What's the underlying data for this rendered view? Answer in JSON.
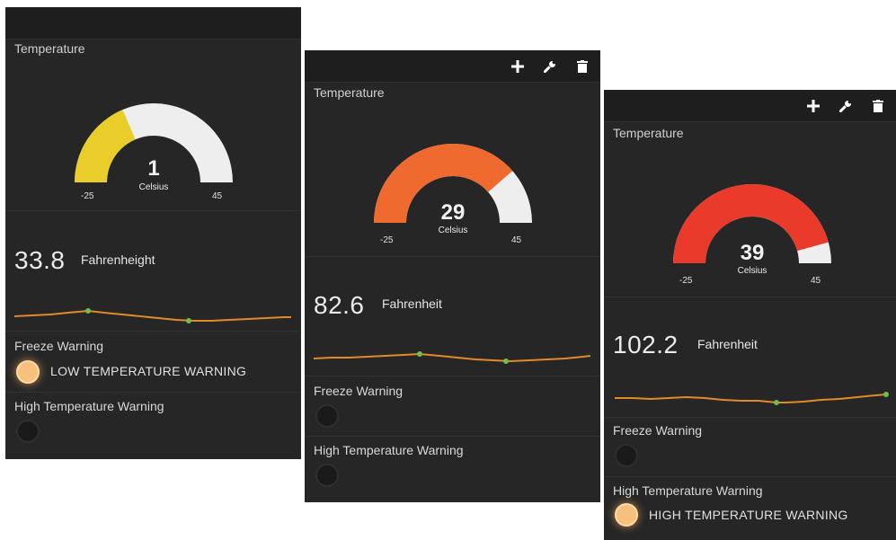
{
  "panels": [
    {
      "temperature_title": "Temperature",
      "gauge": {
        "value": "1",
        "value_num": 1,
        "unit": "Celsius",
        "min": "-25",
        "max": "45",
        "min_num": -25,
        "max_num": 45,
        "color": "#e9cd2a"
      },
      "fahrenheit_value": "33.8",
      "fahrenheit_label": "Fahrenheight",
      "freeze_title": "Freeze Warning",
      "freeze_led_on": true,
      "freeze_led_text": "LOW TEMPERATURE WARNING",
      "high_title": "High Temperature Warning",
      "high_led_on": false,
      "high_led_text": ""
    },
    {
      "tools": [
        "plus-icon",
        "wrench-icon",
        "trash-icon"
      ],
      "temperature_title": "Temperature",
      "gauge": {
        "value": "29",
        "value_num": 29,
        "unit": "Celsius",
        "min": "-25",
        "max": "45",
        "min_num": -25,
        "max_num": 45,
        "color": "#ef6a2e"
      },
      "fahrenheit_value": "82.6",
      "fahrenheit_label": "Fahrenheit",
      "freeze_title": "Freeze Warning",
      "freeze_led_on": false,
      "freeze_led_text": "",
      "high_title": "High Temperature Warning",
      "high_led_on": false,
      "high_led_text": ""
    },
    {
      "tools": [
        "plus-icon",
        "wrench-icon",
        "trash-icon"
      ],
      "temperature_title": "Temperature",
      "gauge": {
        "value": "39",
        "value_num": 39,
        "unit": "Celsius",
        "min": "-25",
        "max": "45",
        "min_num": -25,
        "max_num": 45,
        "color": "#ea3a2b"
      },
      "fahrenheit_value": "102.2",
      "fahrenheit_label": "Fahrenheit",
      "freeze_title": "Freeze Warning",
      "freeze_led_on": false,
      "freeze_led_text": "",
      "high_title": "High Temperature Warning",
      "high_led_on": true,
      "high_led_text": "HIGH TEMPERATURE WARNING"
    }
  ],
  "colors": {
    "panel_bg": "#262626",
    "gauge_track": "#eeeeee",
    "sparkline": "#e08a2a",
    "spark_marker": "#6fbf4a",
    "led_on": "#f7c07d"
  }
}
